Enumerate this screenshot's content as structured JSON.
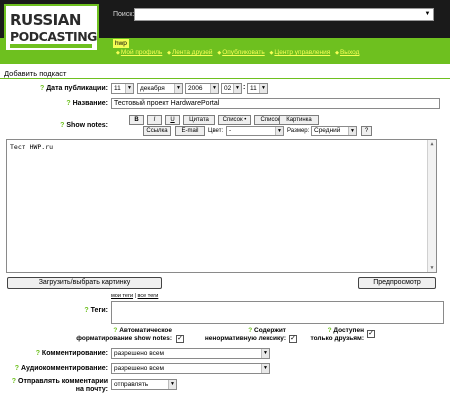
{
  "header": {
    "logo_line1": "RUSSIAN",
    "logo_line2": "PODCASTING",
    "search_label": "Поиск:",
    "search_value": "",
    "user_badge": "hwp",
    "nav": [
      {
        "label": "Мой профиль"
      },
      {
        "label": "Лента друзей"
      },
      {
        "label": "Опубликовать"
      },
      {
        "label": "Центр управления"
      },
      {
        "label": "Выход"
      }
    ]
  },
  "page": {
    "title": "Добавить подкаст"
  },
  "form": {
    "date_label": "Дата публикации:",
    "date": {
      "day": "11",
      "month": "декабря",
      "year": "2006",
      "hour": "02",
      "minute": "11",
      "time_sep": ":"
    },
    "name_label": "Название:",
    "name_value": "Тестовый проект HardwarePortal",
    "shownotes_label": "Show notes:",
    "toolbar": {
      "bold": "B",
      "italic": "I",
      "underline": "U",
      "quote": "Цитата",
      "list": "Список •",
      "list_n": "Список N",
      "image": "Картинка",
      "link": "Ссылка",
      "email": "E-mail",
      "color_label": "Цвет:",
      "color_value": "-",
      "size_label": "Размер:",
      "size_value": "Средний",
      "help": "?"
    },
    "editor_text": "Тест HWP.ru",
    "upload_button": "Загрузить/выбрать картинку",
    "preview_button": "Предпросмотр",
    "tags_label": "Теги:",
    "tags_links": {
      "my": "мои теги",
      "sep": " | ",
      "all": "все теги"
    },
    "tags_value": "",
    "options": [
      {
        "line1": "Автоматическое",
        "line2": "форматирование show notes:",
        "checked": true
      },
      {
        "line1": "Содержит",
        "line2": "ненормативную лексику:",
        "checked": true
      },
      {
        "line1": "Доступен",
        "line2": "только друзьям:",
        "checked": true
      }
    ],
    "comments_label": "Комментирование:",
    "comments_value": "разрешено всем",
    "audio_comments_label": "Аудиокомментирование:",
    "audio_comments_value": "разрешено всем",
    "send_mail_label_1": "Отправлять комментарии",
    "send_mail_label_2": "на почту:",
    "send_mail_value": "отправлять"
  },
  "colors": {
    "brand_green": "#6ec01f",
    "header_bg": "#1a1a1a",
    "badge_yellow": "#f6ff55"
  }
}
